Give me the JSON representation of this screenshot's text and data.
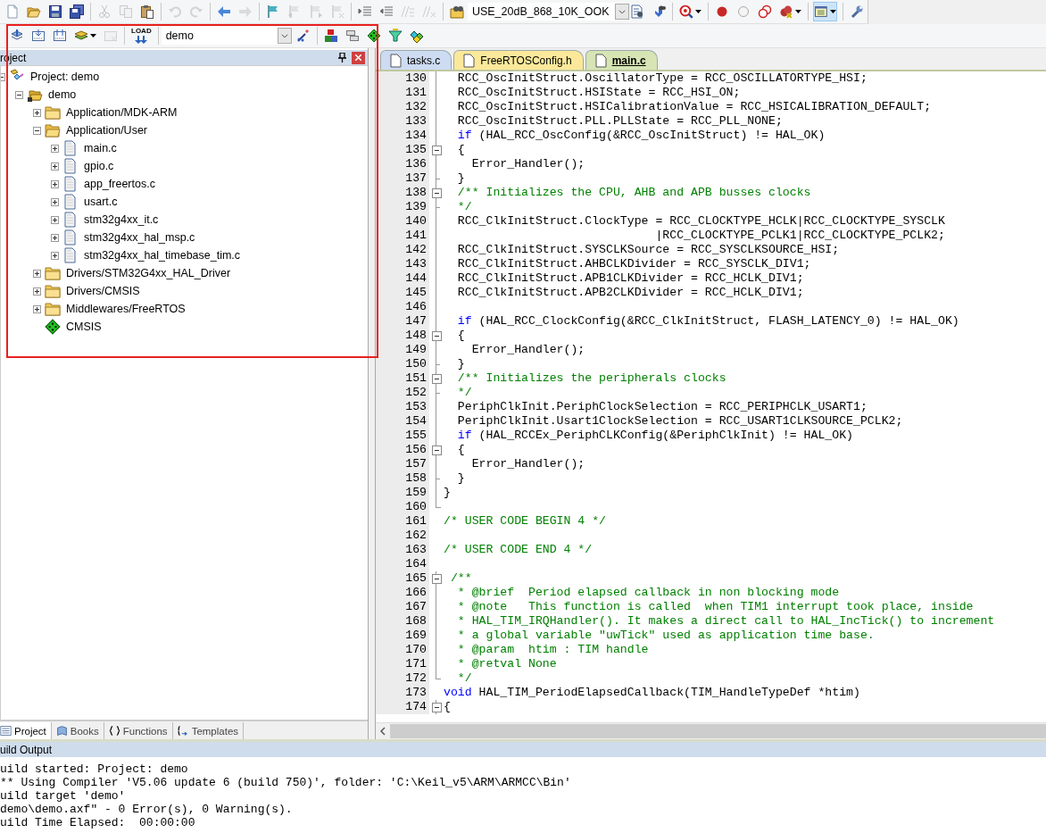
{
  "toolbar_main": [
    {
      "kind": "button",
      "disabled": false,
      "pressed": false
    },
    {
      "kind": "button",
      "disabled": false,
      "pressed": false
    },
    {
      "kind": "button",
      "disabled": false,
      "pressed": false
    },
    {
      "kind": "button",
      "disabled": false,
      "pressed": false
    },
    {
      "kind": "separator"
    },
    {
      "kind": "button",
      "disabled": true,
      "pressed": false
    },
    {
      "kind": "button",
      "disabled": true,
      "pressed": false
    },
    {
      "kind": "button",
      "disabled": false,
      "pressed": false
    },
    {
      "kind": "separator"
    },
    {
      "kind": "button",
      "disabled": true,
      "pressed": false
    },
    {
      "kind": "button",
      "disabled": true,
      "pressed": false
    },
    {
      "kind": "separator"
    },
    {
      "kind": "button",
      "disabled": false,
      "pressed": false
    },
    {
      "kind": "button",
      "disabled": true,
      "pressed": false
    },
    {
      "kind": "separator"
    },
    {
      "kind": "button",
      "disabled": false,
      "pressed": false
    },
    {
      "kind": "button",
      "disabled": true,
      "pressed": false
    },
    {
      "kind": "button",
      "disabled": true,
      "pressed": false
    },
    {
      "kind": "button",
      "disabled": true,
      "pressed": false
    },
    {
      "kind": "separator"
    },
    {
      "kind": "button",
      "disabled": false,
      "pressed": false
    },
    {
      "kind": "button",
      "disabled": false,
      "pressed": false
    },
    {
      "kind": "button",
      "disabled": true,
      "pressed": false
    },
    {
      "kind": "button",
      "disabled": true,
      "pressed": false
    },
    {
      "kind": "separator"
    },
    {
      "kind": "button",
      "disabled": false,
      "pressed": false
    },
    {
      "kind": "combo",
      "value": "USE_20dB_868_10K_OOK"
    },
    {
      "kind": "button",
      "disabled": false,
      "pressed": false
    },
    {
      "kind": "button",
      "disabled": false,
      "pressed": false
    },
    {
      "kind": "separator"
    },
    {
      "kind": "dropdown",
      "disabled": false,
      "pressed": false
    },
    {
      "kind": "separator"
    },
    {
      "kind": "button",
      "disabled": false,
      "pressed": false
    },
    {
      "kind": "button",
      "disabled": false,
      "pressed": false
    },
    {
      "kind": "button",
      "disabled": false,
      "pressed": false
    },
    {
      "kind": "dropdown",
      "disabled": false,
      "pressed": false
    },
    {
      "kind": "separator"
    },
    {
      "kind": "dropdown",
      "disabled": false,
      "pressed": true
    },
    {
      "kind": "separator"
    },
    {
      "kind": "button",
      "disabled": false,
      "pressed": false
    }
  ],
  "toolbar_build": [
    {
      "kind": "button",
      "disabled": false,
      "pressed": false
    },
    {
      "kind": "button",
      "disabled": false,
      "pressed": false
    },
    {
      "kind": "button",
      "disabled": false,
      "pressed": false
    },
    {
      "kind": "dropdown",
      "disabled": false,
      "pressed": false
    },
    {
      "kind": "button",
      "disabled": true,
      "pressed": false
    },
    {
      "kind": "separator"
    },
    {
      "kind": "load",
      "label": "LOAD",
      "disabled": false,
      "pressed": false
    },
    {
      "kind": "separator"
    },
    {
      "kind": "combo",
      "value": "demo"
    },
    {
      "kind": "button",
      "disabled": false,
      "pressed": false
    },
    {
      "kind": "separator"
    },
    {
      "kind": "button",
      "disabled": false,
      "pressed": false
    },
    {
      "kind": "button",
      "disabled": false,
      "pressed": false
    },
    {
      "kind": "button",
      "disabled": false,
      "pressed": false
    },
    {
      "kind": "button",
      "disabled": false,
      "pressed": false
    },
    {
      "kind": "button",
      "disabled": false,
      "pressed": false
    }
  ],
  "project_panel": {
    "title": "roject",
    "tree": [
      {
        "label": "Project: demo",
        "kind": "project",
        "expanded": true,
        "children": [
          {
            "label": "demo",
            "kind": "target",
            "expanded": true,
            "children": [
              {
                "label": "Application/MDK-ARM",
                "kind": "group",
                "expanded": false
              },
              {
                "label": "Application/User",
                "kind": "group",
                "expanded": true,
                "children": [
                  {
                    "label": "main.c",
                    "kind": "file",
                    "expanded": false
                  },
                  {
                    "label": "gpio.c",
                    "kind": "file",
                    "expanded": false
                  },
                  {
                    "label": "app_freertos.c",
                    "kind": "file",
                    "expanded": false
                  },
                  {
                    "label": "usart.c",
                    "kind": "file",
                    "expanded": false
                  },
                  {
                    "label": "stm32g4xx_it.c",
                    "kind": "file",
                    "expanded": false
                  },
                  {
                    "label": "stm32g4xx_hal_msp.c",
                    "kind": "file",
                    "expanded": false
                  },
                  {
                    "label": "stm32g4xx_hal_timebase_tim.c",
                    "kind": "file",
                    "expanded": false
                  }
                ]
              },
              {
                "label": "Drivers/STM32G4xx_HAL_Driver",
                "kind": "group",
                "expanded": false
              },
              {
                "label": "Drivers/CMSIS",
                "kind": "group",
                "expanded": false
              },
              {
                "label": "Middlewares/FreeRTOS",
                "kind": "group",
                "expanded": false
              },
              {
                "label": "CMSIS",
                "kind": "component"
              }
            ]
          }
        ]
      }
    ],
    "tabs": [
      {
        "label": "Project",
        "selected": true
      },
      {
        "label": "Books",
        "selected": false
      },
      {
        "label": "Functions",
        "selected": false
      },
      {
        "label": "Templates",
        "selected": false
      }
    ]
  },
  "editor": {
    "tabs": [
      {
        "label": "tasks.c",
        "selected": false,
        "color": "#cddcf2"
      },
      {
        "label": "FreeRTOSConfig.h",
        "selected": false,
        "color": "#fbe89a"
      },
      {
        "label": "main.c",
        "selected": true,
        "color": "#d7e4b4"
      }
    ],
    "lines": [
      {
        "number": "130",
        "kind": "fold-body",
        "segments": [
          {
            "kind": "code",
            "text": "  RCC_OscInitStruct.OscillatorType = RCC_OSCILLATORTYPE_HSI;"
          }
        ]
      },
      {
        "number": "131",
        "kind": "fold-body",
        "segments": [
          {
            "kind": "code",
            "text": "  RCC_OscInitStruct.HSIState = RCC_HSI_ON;"
          }
        ]
      },
      {
        "number": "132",
        "kind": "fold-body",
        "segments": [
          {
            "kind": "code",
            "text": "  RCC_OscInitStruct.HSICalibrationValue = RCC_HSICALIBRATION_DEFAULT;"
          }
        ]
      },
      {
        "number": "133",
        "kind": "fold-body",
        "segments": [
          {
            "kind": "code",
            "text": "  RCC_OscInitStruct.PLL.PLLState = RCC_PLL_NONE;"
          }
        ]
      },
      {
        "number": "134",
        "kind": "fold-body",
        "segments": [
          {
            "kind": "keyword",
            "text": "  if"
          },
          {
            "kind": "code",
            "text": " (HAL_RCC_OscConfig(&RCC_OscInitStruct) != HAL_OK)"
          }
        ]
      },
      {
        "number": "135",
        "kind": "fold-start",
        "segments": [
          {
            "kind": "code",
            "text": "  {"
          }
        ]
      },
      {
        "number": "136",
        "kind": "fold-body",
        "segments": [
          {
            "kind": "code",
            "text": "    Error_Handler();"
          }
        ]
      },
      {
        "number": "137",
        "kind": "fold-end",
        "segments": [
          {
            "kind": "code",
            "text": "  }"
          }
        ]
      },
      {
        "number": "138",
        "kind": "fold-start",
        "segments": [
          {
            "kind": "comment",
            "text": "  /** Initializes the CPU, AHB and APB busses clocks"
          }
        ]
      },
      {
        "number": "139",
        "kind": "fold-end",
        "segments": [
          {
            "kind": "comment",
            "text": "  */"
          }
        ]
      },
      {
        "number": "140",
        "kind": "fold-body",
        "segments": [
          {
            "kind": "code",
            "text": "  RCC_ClkInitStruct.ClockType = RCC_CLOCKTYPE_HCLK|RCC_CLOCKTYPE_SYSCLK"
          }
        ]
      },
      {
        "number": "141",
        "kind": "fold-body",
        "segments": [
          {
            "kind": "code",
            "text": "                              |RCC_CLOCKTYPE_PCLK1|RCC_CLOCKTYPE_PCLK2;"
          }
        ]
      },
      {
        "number": "142",
        "kind": "fold-body",
        "segments": [
          {
            "kind": "code",
            "text": "  RCC_ClkInitStruct.SYSCLKSource = RCC_SYSCLKSOURCE_HSI;"
          }
        ]
      },
      {
        "number": "143",
        "kind": "fold-body",
        "segments": [
          {
            "kind": "code",
            "text": "  RCC_ClkInitStruct.AHBCLKDivider = RCC_SYSCLK_DIV1;"
          }
        ]
      },
      {
        "number": "144",
        "kind": "fold-body",
        "segments": [
          {
            "kind": "code",
            "text": "  RCC_ClkInitStruct.APB1CLKDivider = RCC_HCLK_DIV1;"
          }
        ]
      },
      {
        "number": "145",
        "kind": "fold-body",
        "segments": [
          {
            "kind": "code",
            "text": "  RCC_ClkInitStruct.APB2CLKDivider = RCC_HCLK_DIV1;"
          }
        ]
      },
      {
        "number": "146",
        "kind": "fold-body"
      },
      {
        "number": "147",
        "kind": "fold-body",
        "segments": [
          {
            "kind": "keyword",
            "text": "  if"
          },
          {
            "kind": "code",
            "text": " (HAL_RCC_ClockConfig(&RCC_ClkInitStruct, FLASH_LATENCY_0) != HAL_OK)"
          }
        ]
      },
      {
        "number": "148",
        "kind": "fold-start",
        "segments": [
          {
            "kind": "code",
            "text": "  {"
          }
        ]
      },
      {
        "number": "149",
        "kind": "fold-body",
        "segments": [
          {
            "kind": "code",
            "text": "    Error_Handler();"
          }
        ]
      },
      {
        "number": "150",
        "kind": "fold-end",
        "segments": [
          {
            "kind": "code",
            "text": "  }"
          }
        ]
      },
      {
        "number": "151",
        "kind": "fold-start",
        "segments": [
          {
            "kind": "comment",
            "text": "  /** Initializes the peripherals clocks"
          }
        ]
      },
      {
        "number": "152",
        "kind": "fold-end",
        "segments": [
          {
            "kind": "comment",
            "text": "  */"
          }
        ]
      },
      {
        "number": "153",
        "kind": "fold-body",
        "segments": [
          {
            "kind": "code",
            "text": "  PeriphClkInit.PeriphClockSelection = RCC_PERIPHCLK_USART1;"
          }
        ]
      },
      {
        "number": "154",
        "kind": "fold-body",
        "segments": [
          {
            "kind": "code",
            "text": "  PeriphClkInit.Usart1ClockSelection = RCC_USART1CLKSOURCE_PCLK2;"
          }
        ]
      },
      {
        "number": "155",
        "kind": "fold-body",
        "segments": [
          {
            "kind": "keyword",
            "text": "  if"
          },
          {
            "kind": "code",
            "text": " (HAL_RCCEx_PeriphCLKConfig(&PeriphClkInit) != HAL_OK)"
          }
        ]
      },
      {
        "number": "156",
        "kind": "fold-start",
        "segments": [
          {
            "kind": "code",
            "text": "  {"
          }
        ]
      },
      {
        "number": "157",
        "kind": "fold-body",
        "segments": [
          {
            "kind": "code",
            "text": "    Error_Handler();"
          }
        ]
      },
      {
        "number": "158",
        "kind": "fold-end",
        "segments": [
          {
            "kind": "code",
            "text": "  }"
          }
        ]
      },
      {
        "number": "159",
        "kind": "fold-body",
        "segments": [
          {
            "kind": "code",
            "text": "}"
          }
        ]
      },
      {
        "number": "160",
        "kind": "fold-last"
      },
      {
        "number": "161",
        "kind": "plain",
        "segments": [
          {
            "kind": "comment",
            "text": "/* USER CODE BEGIN 4 */"
          }
        ]
      },
      {
        "number": "162",
        "kind": "plain"
      },
      {
        "number": "163",
        "kind": "plain",
        "segments": [
          {
            "kind": "comment",
            "text": "/* USER CODE END 4 */"
          }
        ]
      },
      {
        "number": "164",
        "kind": "plain"
      },
      {
        "number": "165",
        "kind": "fold-start",
        "segments": [
          {
            "kind": "comment",
            "text": " /**"
          }
        ]
      },
      {
        "number": "166",
        "kind": "fold-body",
        "segments": [
          {
            "kind": "comment",
            "text": "  * @brief  Period elapsed callback in non blocking mode"
          }
        ]
      },
      {
        "number": "167",
        "kind": "fold-body",
        "segments": [
          {
            "kind": "comment",
            "text": "  * @note   This function is called  when TIM1 interrupt took place, inside"
          }
        ]
      },
      {
        "number": "168",
        "kind": "fold-body",
        "segments": [
          {
            "kind": "comment",
            "text": "  * HAL_TIM_IRQHandler(). It makes a direct call to HAL_IncTick() to increment"
          }
        ]
      },
      {
        "number": "169",
        "kind": "fold-body",
        "segments": [
          {
            "kind": "comment",
            "text": "  * a global variable \"uwTick\" used as application time base."
          }
        ]
      },
      {
        "number": "170",
        "kind": "fold-body",
        "segments": [
          {
            "kind": "comment",
            "text": "  * @param  htim : TIM handle"
          }
        ]
      },
      {
        "number": "171",
        "kind": "fold-body",
        "segments": [
          {
            "kind": "comment",
            "text": "  * @retval None"
          }
        ]
      },
      {
        "number": "172",
        "kind": "fold-last",
        "segments": [
          {
            "kind": "comment",
            "text": "  */"
          }
        ]
      },
      {
        "number": "173",
        "kind": "plain",
        "segments": [
          {
            "kind": "keyword",
            "text": "void"
          },
          {
            "kind": "code",
            "text": " HAL_TIM_PeriodElapsedCallback(TIM_HandleTypeDef *htim)"
          }
        ]
      },
      {
        "number": "174",
        "kind": "fold-start",
        "segments": [
          {
            "kind": "code",
            "text": "{"
          }
        ]
      }
    ]
  },
  "build_output": {
    "title": "uild Output",
    "lines": [
      "uild started: Project: demo",
      "** Using Compiler 'V5.06 update 6 (build 750)', folder: 'C:\\Keil_v5\\ARM\\ARMCC\\Bin'",
      "uild target 'demo'",
      "demo\\demo.axf\" - 0 Error(s), 0 Warning(s).",
      "uild Time Elapsed:  00:00:00"
    ]
  }
}
